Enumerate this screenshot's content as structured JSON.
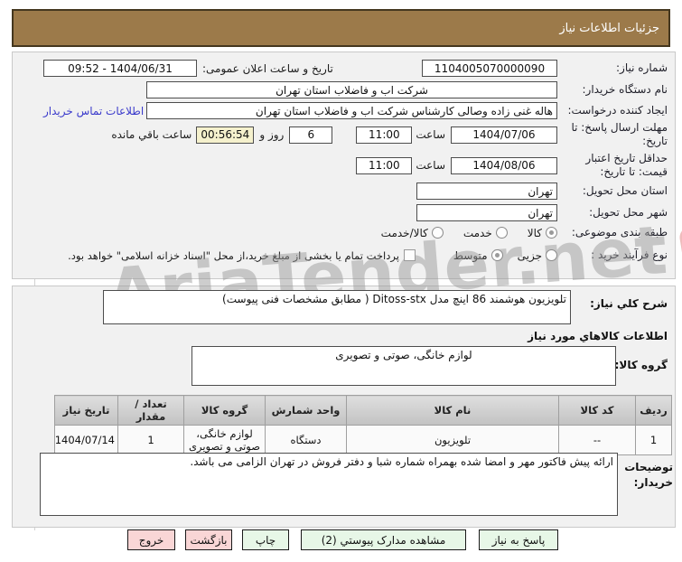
{
  "title_bar": {
    "title": "جزئیات اطلاعات نیاز"
  },
  "panel1": {
    "need_number_label": "شماره نیاز:",
    "need_number_value": "1104005070000090",
    "announce_label": "تاریخ و ساعت اعلان عمومی:",
    "announce_value": "1404/06/31 - 09:52",
    "buyer_org_label": "نام دستگاه خریدار:",
    "buyer_org_value": "شرکت اب و فاضلاب استان تهران",
    "creator_label": "ایجاد کننده درخواست:",
    "creator_value": "هاله غنی زاده وصالی کارشناس شرکت اب و فاضلاب استان تهران",
    "buyer_contact_link": "اطلاعات تماس خریدار",
    "deadline_label": "مهلت ارسال پاسخ: تا تاریخ:",
    "deadline_date": "1404/07/06",
    "hour_label": "ساعت",
    "deadline_time": "11:00",
    "remaining_days": "6",
    "remaining_days_label": "روز و",
    "remaining_countdown": "00:56:54",
    "remaining_suffix": "ساعت باقي مانده",
    "validity_label": "حداقل تاریخ اعتبار قیمت: تا تاریخ:",
    "validity_date": "1404/08/06",
    "validity_time": "11:00",
    "province_label": "استان محل تحویل:",
    "province_value": "تهران",
    "city_label": "شهر محل تحویل:",
    "city_value": "تهران",
    "subject_label": "طبقه بندی موضوعی:",
    "subject_options": [
      {
        "label": "کالا",
        "selected": true
      },
      {
        "label": "خدمت",
        "selected": false
      },
      {
        "label": "کالا/خدمت",
        "selected": false
      }
    ],
    "process_label": "نوع فرآیند خرید :",
    "process_options": [
      {
        "label": "جزیی",
        "selected": false
      },
      {
        "label": "متوسط",
        "selected": true
      }
    ],
    "treasury_label": "پرداخت تمام یا بخشی از مبلغ خرید،از محل \"اسناد خزانه اسلامی\" خواهد بود.",
    "treasury_checked": false
  },
  "panel2": {
    "need_desc_label": "شرح کلي نیاز:",
    "need_desc_value": "تلویزیون هوشمند 86 اینچ مدل Ditoss-stx ( مطابق مشخصات فنی پیوست)",
    "goods_heading": "اطلاعات کالاهاي مورد نیاز",
    "group_label": "گروه کالا:",
    "group_value": "لوازم خانگی، صوتی و تصویری",
    "table": {
      "headers": [
        "ردیف",
        "کد کالا",
        "نام کالا",
        "واحد شمارش",
        "گروه کالا",
        "تعداد / مقدار",
        "تاریخ نیاز"
      ],
      "row": [
        "1",
        "--",
        "تلویزیون",
        "دستگاه",
        "لوازم خانگی، صوتی و تصویری",
        "1",
        "1404/07/14"
      ]
    },
    "notes_label": "توضیحات خریدار:",
    "notes_value": "ارائه پیش فاکتور مهر و امضا شده بهمراه شماره شبا و دفتر فروش در تهران الزامی می باشد."
  },
  "buttons": {
    "reply": "پاسخ به نیاز",
    "view_docs": "مشاهده مدارک پیوستي (2)",
    "print": "چاپ",
    "back": "بازگشت",
    "exit": "خروج"
  },
  "watermark": {
    "text": "AriaTender.net"
  },
  "colors": {
    "titlebar_bg": "#9c7a4a",
    "link": "#3a3acb",
    "countdown_bg": "#f5f1cd",
    "button_green_bg": "#e7f7e7",
    "button_pink_bg": "#f9d6d6"
  }
}
